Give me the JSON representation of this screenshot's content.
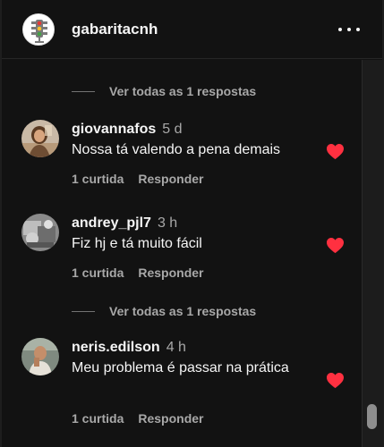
{
  "header": {
    "username": "gabaritacnh",
    "more_icon": "more-horizontal-icon"
  },
  "comments": [
    {
      "view_replies": "Ver todas as 1 respostas",
      "username": "giovannafos",
      "time": "5 d",
      "text": "Nossa tá valendo a pena demais",
      "likes": "1 curtida",
      "reply": "Responder",
      "liked": true
    },
    {
      "username": "andrey_pjl7",
      "time": "3 h",
      "text": "Fiz hj e tá muito fácil",
      "likes": "1 curtida",
      "reply": "Responder",
      "liked": true
    },
    {
      "view_replies": "Ver todas as 1 respostas",
      "username": "neris.edilson",
      "time": "4 h",
      "text": "Meu problema é passar na prática",
      "likes": "1 curtida",
      "reply": "Responder",
      "liked": true
    }
  ],
  "colors": {
    "background": "#121212",
    "heart": "#ff3040",
    "secondary_text": "#a8a8a8"
  }
}
